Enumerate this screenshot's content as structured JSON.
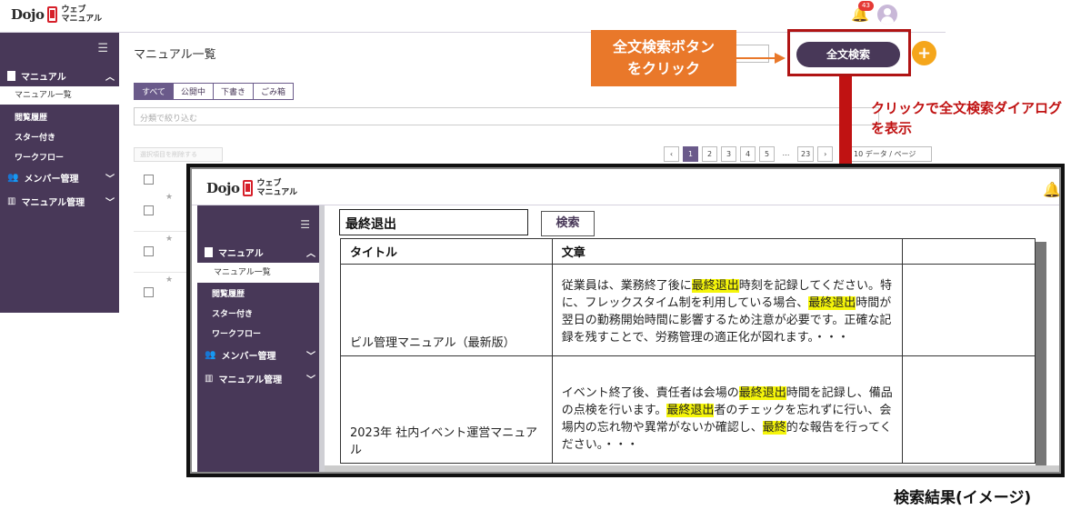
{
  "app": {
    "logo_text": "Dojo",
    "logo_sub_line1": "ウェブ",
    "logo_sub_line2": "マニュアル",
    "notification_count": "43"
  },
  "sidebar": {
    "manual_section": "マニュアル",
    "items": [
      "マニュアル一覧",
      "閲覧履歴",
      "スター付き",
      "ワークフロー"
    ],
    "member_section": "メンバー管理",
    "manual_admin_section": "マニュアル管理"
  },
  "content": {
    "title": "マニュアル一覧",
    "tabs": [
      "すべて",
      "公開中",
      "下書き",
      "ごみ箱"
    ],
    "category_placeholder": "分類で絞り込む",
    "bulk_button": "選択項目を削除する",
    "pager": [
      "‹",
      "1",
      "2",
      "3",
      "4",
      "5",
      "…",
      "23",
      "›"
    ],
    "per_page": "10 データ / ページ"
  },
  "fts": {
    "button_label": "全文検索",
    "plus_label": "+"
  },
  "annotations": {
    "orange_callout_line1": "全文検索ボタン",
    "orange_callout_line2": "をクリック",
    "red_note_line1": "クリックで全文検索ダイアログ",
    "red_note_line2": "を表示",
    "caption": "検索結果(イメージ)"
  },
  "dialog": {
    "search_value": "最終退出",
    "search_button": "検索",
    "columns": [
      "タイトル",
      "文章",
      ""
    ],
    "rows": [
      {
        "title": "ビル管理マニュアル（最新版）",
        "body_parts": [
          {
            "t": "従業員は、業務終了後に",
            "h": false
          },
          {
            "t": "最終退出",
            "h": true
          },
          {
            "t": "時刻を記録してください。特に、フレックスタイム制を利用している場合、",
            "h": false
          },
          {
            "t": "最終退出",
            "h": true
          },
          {
            "t": "時間が翌日の勤務開始時間に影響するため注意が必要です。正確な記録を残すことで、労務管理の適正化が図れます。・・・",
            "h": false
          }
        ]
      },
      {
        "title": "2023年 社内イベント運営マニュアル",
        "body_parts": [
          {
            "t": "イベント終了後、責任者は会場の",
            "h": false
          },
          {
            "t": "最終退出",
            "h": true
          },
          {
            "t": "時間を記録し、備品の点検を行います。",
            "h": false
          },
          {
            "t": "最終退出",
            "h": true
          },
          {
            "t": "者のチェックを忘れずに行い、会場内の忘れ物や異常がないか確認し、",
            "h": false
          },
          {
            "t": "最終",
            "h": true
          },
          {
            "t": "的な報告を行ってください。・・・",
            "h": false
          }
        ]
      }
    ]
  },
  "colors": {
    "brand_purple": "#483858",
    "accent_orange": "#e9782a",
    "alert_red": "#c01212",
    "highlight_yellow": "#f5f50a"
  }
}
